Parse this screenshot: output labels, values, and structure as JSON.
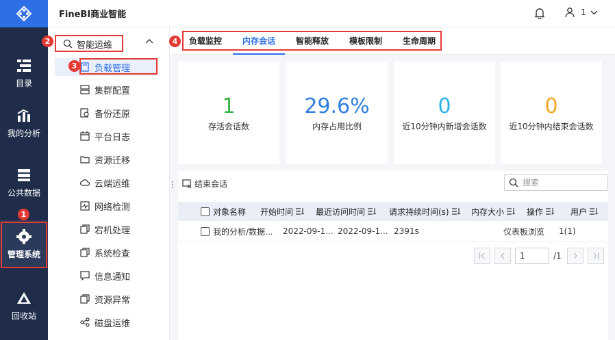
{
  "header": {
    "title": "FineBI商业智能",
    "user": "1"
  },
  "leftnav": {
    "items": [
      {
        "label": "目录"
      },
      {
        "label": "我的分析"
      },
      {
        "label": "公共数据"
      },
      {
        "label": "管理系统"
      },
      {
        "label": "回收站"
      }
    ]
  },
  "sidebar": {
    "group": "智能运维",
    "items": [
      {
        "label": "负载管理"
      },
      {
        "label": "集群配置"
      },
      {
        "label": "备份还原"
      },
      {
        "label": "平台日志"
      },
      {
        "label": "资源迁移"
      },
      {
        "label": "云端运维"
      },
      {
        "label": "网络检测"
      },
      {
        "label": "宕机处理"
      },
      {
        "label": "系统检查"
      },
      {
        "label": "信息通知"
      },
      {
        "label": "资源异常"
      },
      {
        "label": "磁盘运维"
      }
    ]
  },
  "tabs": [
    {
      "label": "负载监控"
    },
    {
      "label": "内存会话"
    },
    {
      "label": "智能释放"
    },
    {
      "label": "模板限制"
    },
    {
      "label": "生命周期"
    }
  ],
  "stats": [
    {
      "value": "1",
      "label": "存活会话数",
      "color": "#3bb54a"
    },
    {
      "value": "29.6%",
      "label": "内存占用比例",
      "color": "#2f7fe0"
    },
    {
      "value": "0",
      "label": "近10分钟内新增会话数",
      "color": "#2bb3e8"
    },
    {
      "value": "0",
      "label": "近10分钟内结束会话数",
      "color": "#f5a623"
    }
  ],
  "toolbar": {
    "end_session": "结束会话",
    "search_placeholder": "搜索"
  },
  "table": {
    "columns": [
      "对象名称",
      "开始时间",
      "最近访问时间",
      "请求持续时间(s)",
      "内存大小",
      "操作",
      "用户"
    ],
    "rows": [
      [
        "我的分析/数据...",
        "2022-09-1...",
        "2022-09-1...",
        "2391s",
        "",
        "仪表板浏览",
        "1(1)"
      ]
    ]
  },
  "pager": {
    "page": "1",
    "total": "/1"
  },
  "annotations": {
    "b1": "1",
    "b2": "2",
    "b3": "3",
    "b4": "4"
  },
  "colors": {
    "accent": "#2f6fe6",
    "nav_bg": "#1f2d4a",
    "annotation": "#e53935"
  }
}
